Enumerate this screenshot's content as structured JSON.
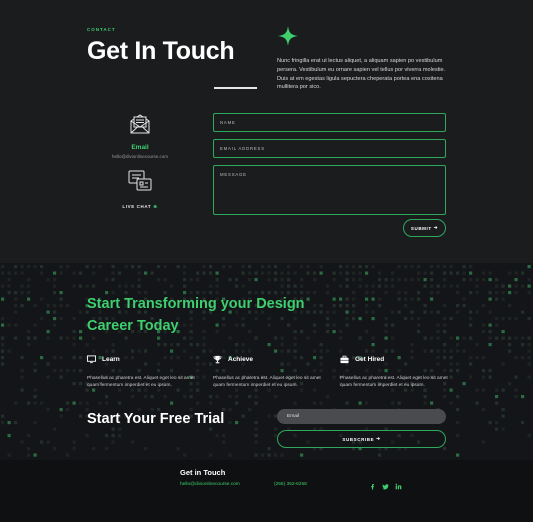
{
  "contact": {
    "eyebrow": "CONTACT",
    "title": "Get In Touch",
    "intro": "Nunc fringilla erat ut lectus aliquet, a aliquam sapien po vestibulum persera. Vestibulum eu ornare sapien vel tellus por viverra molestie. Duis at em egestas ligula sepuctera cheperata portea ena cositena mullitera por sico.",
    "email_label": "Email",
    "email_address": "hello@divionlinecourse.com",
    "chat_label": "LIVE CHAT",
    "chat_plus": "⊕",
    "form": {
      "name_placeholder": "NAME",
      "email_placeholder": "EMAIL ADDRESS",
      "message_placeholder": "MESSAGE",
      "submit_label": "SUBMIT",
      "submit_arrow": "➔"
    }
  },
  "career": {
    "title": "Start Transforming your Design Career Today",
    "features": [
      {
        "icon": "monitor-icon",
        "label": "Learn",
        "text": "Phasellus ac pharetra est. Aliquet eget leo sit amet quam fermentum imperdiet et eu ipsum."
      },
      {
        "icon": "trophy-icon",
        "label": "Achieve",
        "text": "Phasellus ac pharetra est. Aliquet eget leo sit amet quam fermentum imperdiet et eu ipsum."
      },
      {
        "icon": "briefcase-icon",
        "label": "Get Hired",
        "text": "Phasellus ac pharetra est. Aliquet eget leo sit amet quam fermentum imperdiet et eu ipsum."
      }
    ],
    "trial_title": "Start Your Free Trial",
    "email_placeholder": "Email",
    "subscribe_label": "SUBSCRIBE",
    "subscribe_arrow": "➔"
  },
  "footer": {
    "title": "Get in Touch",
    "email": "hello@divionlinecourse.com",
    "phone": "(255) 352-6258",
    "social": [
      "facebook-icon",
      "twitter-icon",
      "linkedin-icon"
    ]
  },
  "colors": {
    "accent": "#3ecf6e",
    "accent_border": "#2fa85c",
    "background": "#1b1c1e",
    "dark": "#141518"
  }
}
